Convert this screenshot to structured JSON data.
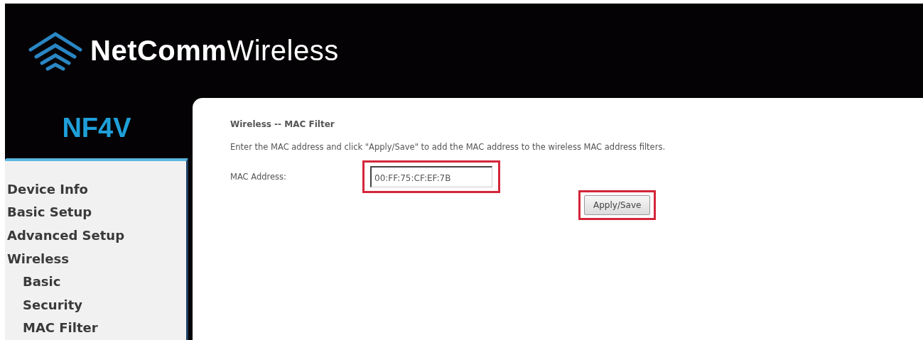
{
  "header": {
    "brand": "**NetComm**Wireless"
  },
  "model": "NF4V",
  "sidebar": {
    "items": [
      {
        "label": "Device Info"
      },
      {
        "label": "Basic Setup"
      },
      {
        "label": "Advanced Setup"
      },
      {
        "label": "Wireless",
        "children": [
          {
            "label": "Basic"
          },
          {
            "label": "Security"
          },
          {
            "label": "MAC Filter"
          }
        ]
      }
    ]
  },
  "content": {
    "title": "Wireless -- MAC Filter",
    "description": "Enter the MAC address and click \"Apply/Save\" to add the MAC address to the wireless MAC address filters.",
    "mac_label": "MAC Address:",
    "mac_value": "00:FF:75:CF:EF:7B",
    "button": "Apply/Save"
  }
}
